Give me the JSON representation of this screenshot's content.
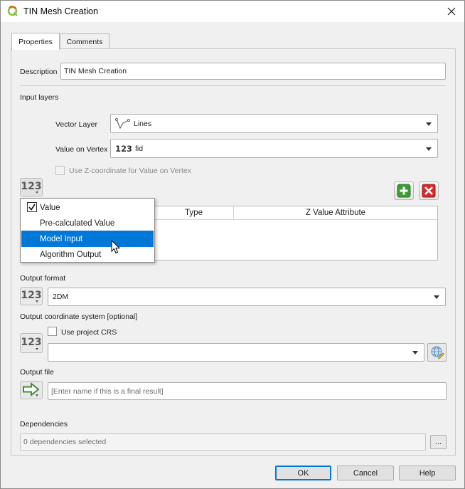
{
  "window": {
    "title": "TIN Mesh Creation"
  },
  "tabs": [
    {
      "label": "Properties",
      "active": true
    },
    {
      "label": "Comments",
      "active": false
    }
  ],
  "form": {
    "description_label": "Description",
    "description_value": "TIN Mesh Creation",
    "input_layers_label": "Input layers",
    "vector_layer_label": "Vector Layer",
    "vector_layer_value": "Lines",
    "value_on_vertex_label": "Value on Vertex",
    "value_on_vertex_prefix": "123",
    "value_on_vertex_value": "fid",
    "use_z_label": "Use Z-coordinate for Value on Vertex",
    "source_button_label": "123",
    "table_headers": [
      "Type",
      "Z Value Attribute"
    ],
    "output_format_label": "Output format",
    "output_format_value": "2DM",
    "crs_label": "Output coordinate system [optional]",
    "use_project_crs_label": "Use project CRS",
    "crs_value": "",
    "output_file_label": "Output file",
    "output_file_placeholder": "[Enter name if this is a final result]",
    "dependencies_label": "Dependencies",
    "dependencies_value": "0 dependencies selected",
    "dependencies_button": "..."
  },
  "dropdown": {
    "items": [
      {
        "label": "Value",
        "checked": true,
        "selected": false
      },
      {
        "label": "Pre-calculated Value",
        "checked": false,
        "selected": false
      },
      {
        "label": "Model Input",
        "checked": false,
        "selected": true
      },
      {
        "label": "Algorithm Output",
        "checked": false,
        "selected": false
      }
    ]
  },
  "buttons": {
    "ok": "OK",
    "cancel": "Cancel",
    "help": "Help"
  },
  "icons": {
    "app": "qgis-logo-icon",
    "add": "plus-icon",
    "remove": "x-icon",
    "vector": "line-layer-icon",
    "output": "arrow-right-icon",
    "crs": "globe-icon"
  },
  "colors": {
    "selection": "#0078d7",
    "add_green": "#3d9b35",
    "remove_red": "#d42a2a"
  }
}
